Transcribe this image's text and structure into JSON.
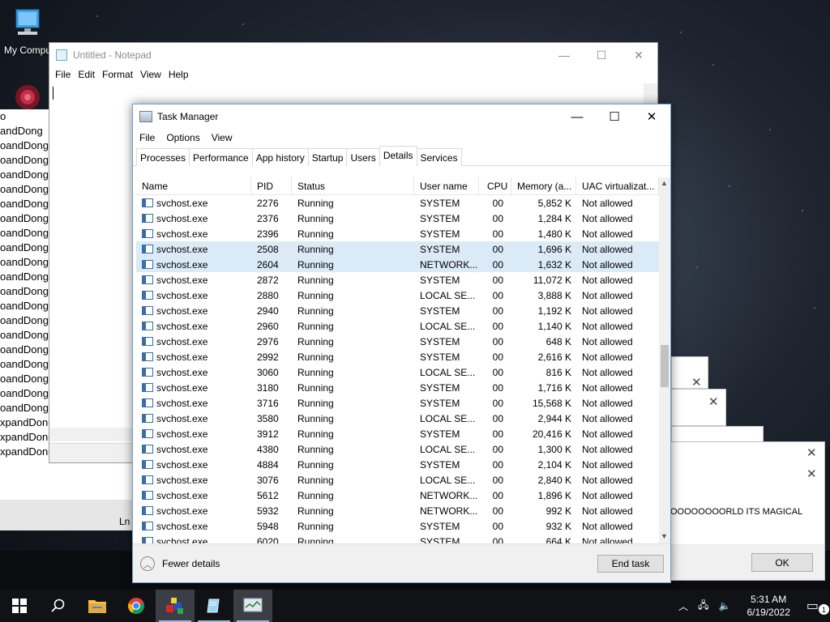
{
  "desktop": {
    "my_computer_label": "My Compu",
    "bg_window_lines": [
      "o",
      "andDong",
      "oandDong",
      "oandDong",
      "oandDong",
      "oandDong",
      "oandDong",
      "oandDong",
      "oandDong",
      "oandDong",
      "oandDong",
      "oandDong",
      "oandDong",
      "oandDong",
      "oandDong",
      "oandDong",
      "oandDong",
      "oandDong",
      "oandDong",
      "oandDong",
      "oandDong",
      "xpandDongExpandDongExp",
      "xpandDongExpandDongExp",
      "xpandDongExpandDongExp"
    ],
    "bg_window_status": "Ln"
  },
  "notepad": {
    "title": "Untitled - Notepad",
    "menu": [
      "File",
      "Edit",
      "Format",
      "View",
      "Help"
    ]
  },
  "message_box": {
    "text": "OOOOOOOORLD ITS MAGICAL",
    "ok_label": "OK",
    "close_glyph": "✕"
  },
  "task_manager": {
    "title": "Task Manager",
    "menu": [
      "File",
      "Options",
      "View"
    ],
    "tabs": [
      "Processes",
      "Performance",
      "App history",
      "Startup",
      "Users",
      "Details",
      "Services"
    ],
    "active_tab": "Details",
    "columns": [
      "Name",
      "PID",
      "Status",
      "User name",
      "CPU",
      "Memory (a...",
      "UAC virtualizat..."
    ],
    "rows": [
      {
        "name": "svchost.exe",
        "pid": "2276",
        "status": "Running",
        "user": "SYSTEM",
        "cpu": "00",
        "mem": "5,852 K",
        "uac": "Not allowed",
        "selected": false
      },
      {
        "name": "svchost.exe",
        "pid": "2376",
        "status": "Running",
        "user": "SYSTEM",
        "cpu": "00",
        "mem": "1,284 K",
        "uac": "Not allowed",
        "selected": false
      },
      {
        "name": "svchost.exe",
        "pid": "2396",
        "status": "Running",
        "user": "SYSTEM",
        "cpu": "00",
        "mem": "1,480 K",
        "uac": "Not allowed",
        "selected": false
      },
      {
        "name": "svchost.exe",
        "pid": "2508",
        "status": "Running",
        "user": "SYSTEM",
        "cpu": "00",
        "mem": "1,696 K",
        "uac": "Not allowed",
        "selected": true
      },
      {
        "name": "svchost.exe",
        "pid": "2604",
        "status": "Running",
        "user": "NETWORK...",
        "cpu": "00",
        "mem": "1,632 K",
        "uac": "Not allowed",
        "selected": true
      },
      {
        "name": "svchost.exe",
        "pid": "2872",
        "status": "Running",
        "user": "SYSTEM",
        "cpu": "00",
        "mem": "11,072 K",
        "uac": "Not allowed",
        "selected": false
      },
      {
        "name": "svchost.exe",
        "pid": "2880",
        "status": "Running",
        "user": "LOCAL SE...",
        "cpu": "00",
        "mem": "3,888 K",
        "uac": "Not allowed",
        "selected": false
      },
      {
        "name": "svchost.exe",
        "pid": "2940",
        "status": "Running",
        "user": "SYSTEM",
        "cpu": "00",
        "mem": "1,192 K",
        "uac": "Not allowed",
        "selected": false
      },
      {
        "name": "svchost.exe",
        "pid": "2960",
        "status": "Running",
        "user": "LOCAL SE...",
        "cpu": "00",
        "mem": "1,140 K",
        "uac": "Not allowed",
        "selected": false
      },
      {
        "name": "svchost.exe",
        "pid": "2976",
        "status": "Running",
        "user": "SYSTEM",
        "cpu": "00",
        "mem": "648 K",
        "uac": "Not allowed",
        "selected": false
      },
      {
        "name": "svchost.exe",
        "pid": "2992",
        "status": "Running",
        "user": "SYSTEM",
        "cpu": "00",
        "mem": "2,616 K",
        "uac": "Not allowed",
        "selected": false
      },
      {
        "name": "svchost.exe",
        "pid": "3060",
        "status": "Running",
        "user": "LOCAL SE...",
        "cpu": "00",
        "mem": "816 K",
        "uac": "Not allowed",
        "selected": false
      },
      {
        "name": "svchost.exe",
        "pid": "3180",
        "status": "Running",
        "user": "SYSTEM",
        "cpu": "00",
        "mem": "1,716 K",
        "uac": "Not allowed",
        "selected": false
      },
      {
        "name": "svchost.exe",
        "pid": "3716",
        "status": "Running",
        "user": "SYSTEM",
        "cpu": "00",
        "mem": "15,568 K",
        "uac": "Not allowed",
        "selected": false
      },
      {
        "name": "svchost.exe",
        "pid": "3580",
        "status": "Running",
        "user": "LOCAL SE...",
        "cpu": "00",
        "mem": "2,944 K",
        "uac": "Not allowed",
        "selected": false
      },
      {
        "name": "svchost.exe",
        "pid": "3912",
        "status": "Running",
        "user": "SYSTEM",
        "cpu": "00",
        "mem": "20,416 K",
        "uac": "Not allowed",
        "selected": false
      },
      {
        "name": "svchost.exe",
        "pid": "4380",
        "status": "Running",
        "user": "LOCAL SE...",
        "cpu": "00",
        "mem": "1,300 K",
        "uac": "Not allowed",
        "selected": false
      },
      {
        "name": "svchost.exe",
        "pid": "4884",
        "status": "Running",
        "user": "SYSTEM",
        "cpu": "00",
        "mem": "2,104 K",
        "uac": "Not allowed",
        "selected": false
      },
      {
        "name": "svchost.exe",
        "pid": "3076",
        "status": "Running",
        "user": "LOCAL SE...",
        "cpu": "00",
        "mem": "2,840 K",
        "uac": "Not allowed",
        "selected": false
      },
      {
        "name": "svchost.exe",
        "pid": "5612",
        "status": "Running",
        "user": "NETWORK...",
        "cpu": "00",
        "mem": "1,896 K",
        "uac": "Not allowed",
        "selected": false
      },
      {
        "name": "svchost.exe",
        "pid": "5932",
        "status": "Running",
        "user": "NETWORK...",
        "cpu": "00",
        "mem": "992 K",
        "uac": "Not allowed",
        "selected": false
      },
      {
        "name": "svchost.exe",
        "pid": "5948",
        "status": "Running",
        "user": "SYSTEM",
        "cpu": "00",
        "mem": "932 K",
        "uac": "Not allowed",
        "selected": false
      },
      {
        "name": "svchost.exe",
        "pid": "6020",
        "status": "Running",
        "user": "SYSTEM",
        "cpu": "00",
        "mem": "664 K",
        "uac": "Not allowed",
        "selected": false
      }
    ],
    "fewer_details_label": "Fewer details",
    "end_task_label": "End task",
    "selection_color": "#dbeaf7"
  },
  "taskbar": {
    "apps": [
      "windows-start",
      "search",
      "file-explorer",
      "chrome",
      "bouncing-cubes",
      "notepad",
      "task-manager"
    ],
    "time": "5:31 AM",
    "date": "6/19/2022",
    "notification_count": "1"
  }
}
